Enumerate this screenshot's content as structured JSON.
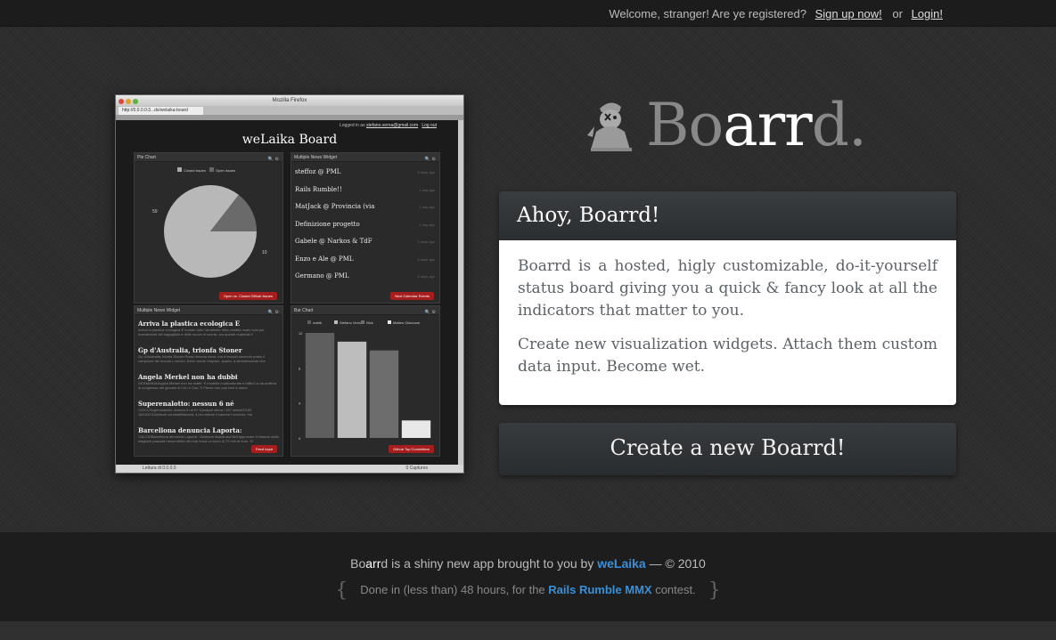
{
  "topbar": {
    "welcome": "Welcome, stranger! Are ye registered?",
    "signup": "Sign up now!",
    "or": "or",
    "login": "Login!"
  },
  "screenshot": {
    "window_title": "Mozilla Firefox",
    "tab_url": "http://0.0.0.0:3...ds/welaika-board",
    "logged_in": "Logged in as",
    "user_email": "stefano.verna@gmail.com",
    "logout": "Log out",
    "board_title": "weLaika Board",
    "pie_widget": {
      "title": "Pie Chart",
      "legend": [
        "Closed issues",
        "Open issues"
      ],
      "label_left": "59",
      "label_right": "10",
      "button": "Open vs. Closed Github Issues"
    },
    "news_widget_1": {
      "title": "Multiple News Widget",
      "items": [
        {
          "title": "steffoz @ PML",
          "ago": "3 days ago"
        },
        {
          "title": "Rails Rumble!!",
          "ago": "1 day ago"
        },
        {
          "title": "MatJack @ Provincia (via",
          "ago": "1 day ago"
        },
        {
          "title": "Definizione progetto",
          "ago": "1 day ago"
        },
        {
          "title": "Gabele @ Narkos & TdF",
          "ago": "4 days ago"
        },
        {
          "title": "Enzo e Ale @ PML",
          "ago": "4 days ago"
        },
        {
          "title": "Germano @ PML",
          "ago": "4 days ago"
        }
      ],
      "button": "Next Calendar Events"
    },
    "news_widget_2": {
      "title": "Multiple News Widget",
      "items": [
        {
          "title": "Arriva la plastica ecologica E",
          "desc": "Arriva la plastica ecologica E mondo tutto l'ambiente ritira vendita usato solo per investimenti del bagagliaio e delle nuove di scorta, ora queste materiali è"
        },
        {
          "title": "Gp d'Australia, trionfa Stoner",
          "desc": "Gp d'Australia, trionfa Stoner Rossi rimonta show, ma è terzoAl secondo posto il campione del mondo Lorenzo. Bene anche Hayden, quarto, a dimostrazione che"
        },
        {
          "title": "Angela Merkel non ha dubbi",
          "desc": "GERMANIAAngela Merkel non ha dubbi: 'Il modello multiculturale è fallito'La cancelliera al congresso dei giovani di Cdu e Csu: 'Il Paese non può fare a meno"
        },
        {
          "title": "Superenalotto: nessun 6 né",
          "desc": "CIOCCSuperenalotto: nessun 6 né 5+ il jackpot sfiora i 167 milioni23:05 16/10/2010Articoli correlatiMarcicia, il pm chiede il carcere l'omicida: 'Ha"
        },
        {
          "title": "Barcellona denuncia Laporta:",
          "desc": "CALCIOBarcellona denuncia Laporta: 'Gestione disastrosa'Nell'approvare il bilancio della stagione passata l'assemblea dei club trova un buco di 79 mln di euro. 'E"
        }
      ],
      "button": "Feed Input"
    },
    "bar_widget": {
      "title": "Bar Chart",
      "button": "Github Top Committers"
    },
    "status_text": "Lettura di 0.0.0.0",
    "status_right": "0 Captures"
  },
  "chart_data": {
    "type": "bar",
    "categories": [
      "mattb",
      "Stefano Verna",
      "Nick",
      "Matteo Giaccone"
    ],
    "values": [
      12,
      11,
      10,
      2
    ],
    "ylim": [
      0,
      12
    ],
    "yticks": [
      "0",
      "4",
      "8",
      "12"
    ],
    "colors": [
      "#5e5e5e",
      "#bdbdbd",
      "#6d6d6d",
      "#e8e8e8"
    ]
  },
  "pie_data": {
    "values": [
      59,
      10
    ],
    "colors": [
      "#b8b8b8",
      "#6a6a6a"
    ]
  },
  "brand": {
    "name_gray_1": "Bo",
    "name_white": "arr",
    "name_gray_2": "d."
  },
  "ahoy": {
    "title": "Ahoy, Boarrd!",
    "p1": "Boarrd is a hosted, higly customizable, do-it-yourself status board giving you a quick & fancy look at all the indicators that matter to you.",
    "p2": "Create new visualization widgets. Attach them custom data input. Become wet."
  },
  "create_button": "Create a new Boarrd!",
  "footer": {
    "brand_1": "Bo",
    "brand_2": "arr",
    "brand_3": "d",
    "tagline": " is a shiny new app brought to you by ",
    "company": "weLaika",
    "copyright": " — © 2010",
    "open_brace": "{",
    "done": "Done in (less than) 48 hours, for the ",
    "contest": "Rails Rumble MMX",
    "contest_suffix": " contest.",
    "close_brace": "}"
  }
}
